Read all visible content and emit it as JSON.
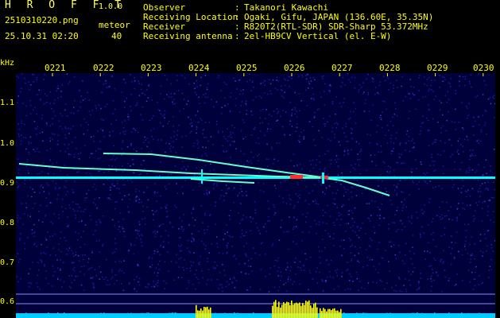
{
  "header": {
    "app_name": "H R O F F T",
    "app_version": "1.0.0",
    "filename": "2510310220.png",
    "meteor_label": "meteor",
    "datetime": "25.10.31 02:20",
    "meteor_count": "40"
  },
  "info": [
    {
      "label": "Observer",
      "value": "Takanori Kawachi"
    },
    {
      "label": "Receiving Location",
      "value": "Ogaki, Gifu, JAPAN (136.60E, 35.35N)"
    },
    {
      "label": "Receiver",
      "value": "R820T2(RTL-SDR) SDR-Sharp 53.372MHz"
    },
    {
      "label": "Receiving antenna",
      "value": "2el-HB9CV Vertical (el. E-W)"
    }
  ],
  "info_separator": ":",
  "spectrogram": {
    "y_unit": "kHz",
    "y_ticks": [
      "1.1",
      "1.0",
      "0.9",
      "0.8",
      "0.7",
      "0.6"
    ],
    "x_ticks": [
      "0221",
      "0222",
      "0223",
      "0224",
      "0225",
      "0226",
      "0227",
      "0228",
      "0229",
      "0230"
    ],
    "colors": {
      "background": "#00003a",
      "noise": "#1a1aa0",
      "carrier": "#00ffff",
      "trail": "#66ffcc",
      "hot": "#ff3030",
      "level": "#ffff00",
      "level_base": "#00ccff",
      "text": "#ffff00"
    }
  }
}
